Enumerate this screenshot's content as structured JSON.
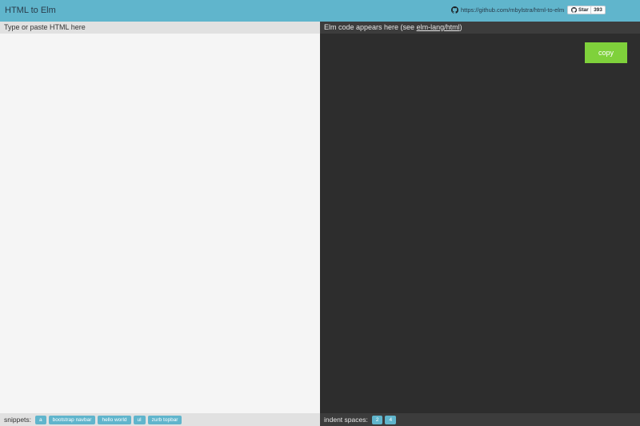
{
  "header": {
    "title": "HTML to Elm",
    "repo_url": "https://github.com/mbylstra/html-to-elm",
    "star_label": "Star",
    "star_count": "393"
  },
  "input_panel": {
    "heading": "Type or paste HTML here",
    "value": ""
  },
  "output_panel": {
    "heading_prefix": "Elm code appears here (see ",
    "heading_link": "elm-lang/html",
    "heading_suffix": ")",
    "copy_label": "copy"
  },
  "snippets": {
    "label": "snippets:",
    "items": [
      "a",
      "bootstrap navbar",
      "hello world",
      "ul",
      "zurb topbar"
    ]
  },
  "indent": {
    "label": "indent spaces:",
    "options": [
      "2",
      "4"
    ]
  },
  "colors": {
    "header_bg": "#60b5cc",
    "output_bg": "#2d2d2d",
    "copy_button": "#7fd13b",
    "chip_bg": "#60b5cc"
  },
  "icons": {
    "repo_link": "github-icon",
    "star_button": "github-icon"
  }
}
